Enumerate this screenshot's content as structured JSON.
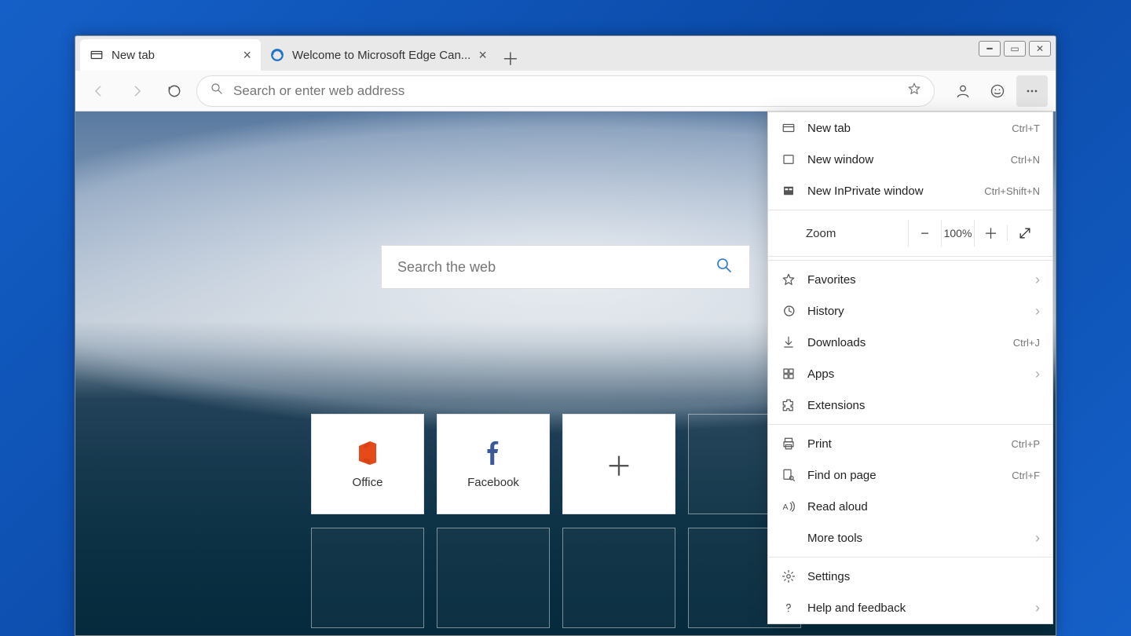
{
  "tabs": [
    {
      "title": "New tab",
      "icon": "newtab"
    },
    {
      "title": "Welcome to Microsoft Edge Can...",
      "icon": "edge"
    }
  ],
  "omnibox": {
    "placeholder": "Search or enter web address"
  },
  "newtab_search": {
    "placeholder": "Search the web"
  },
  "tiles": [
    {
      "label": "Office",
      "icon": "office"
    },
    {
      "label": "Facebook",
      "icon": "facebook"
    }
  ],
  "menu": {
    "sections": [
      [
        {
          "label": "New tab",
          "shortcut": "Ctrl+T",
          "icon": "newtab"
        },
        {
          "label": "New window",
          "shortcut": "Ctrl+N",
          "icon": "window"
        },
        {
          "label": "New InPrivate window",
          "shortcut": "Ctrl+Shift+N",
          "icon": "inprivate"
        }
      ],
      "zoom",
      [
        {
          "label": "Favorites",
          "chevron": true,
          "icon": "star"
        },
        {
          "label": "History",
          "chevron": true,
          "icon": "history"
        },
        {
          "label": "Downloads",
          "shortcut": "Ctrl+J",
          "icon": "download"
        },
        {
          "label": "Apps",
          "chevron": true,
          "icon": "apps"
        },
        {
          "label": "Extensions",
          "icon": "extension"
        }
      ],
      [
        {
          "label": "Print",
          "shortcut": "Ctrl+P",
          "icon": "print"
        },
        {
          "label": "Find on page",
          "shortcut": "Ctrl+F",
          "icon": "find"
        },
        {
          "label": "Read aloud",
          "icon": "readaloud"
        },
        {
          "label": "More tools",
          "chevron": true,
          "icon": ""
        }
      ],
      [
        {
          "label": "Settings",
          "icon": "gear"
        },
        {
          "label": "Help and feedback",
          "chevron": true,
          "icon": "help"
        }
      ]
    ],
    "zoom": {
      "label": "Zoom",
      "value": "100%"
    }
  }
}
